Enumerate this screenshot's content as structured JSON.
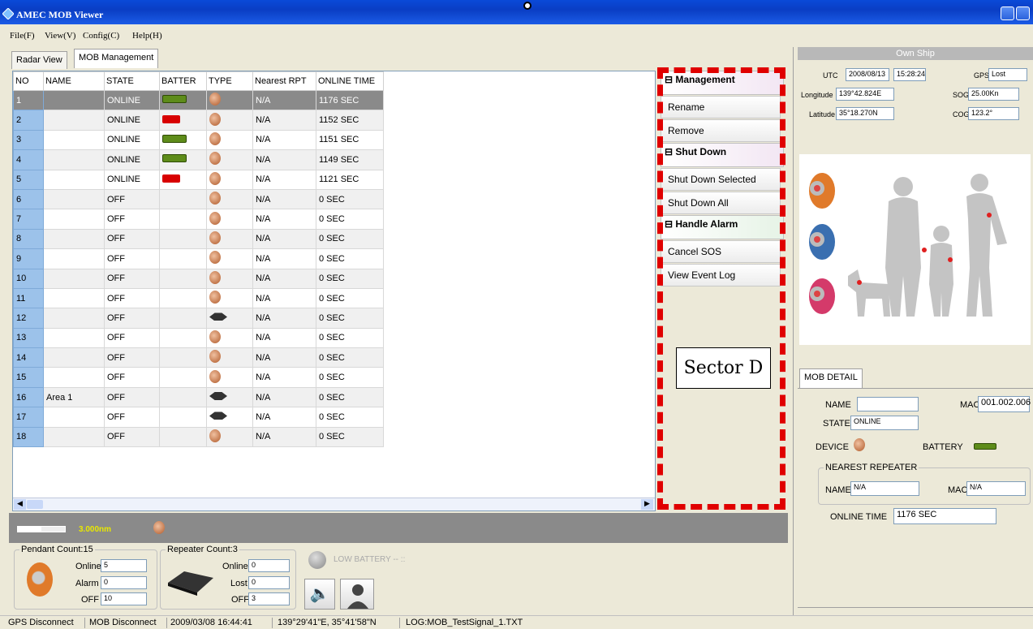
{
  "window": {
    "title": "AMEC MOB Viewer"
  },
  "menu": [
    "File(F)",
    "View(V)",
    "Config(C)",
    "Help(H)"
  ],
  "tabs": [
    "Radar View",
    "MOB Management"
  ],
  "grid": {
    "columns": [
      "NO",
      "NAME",
      "STATE",
      "BATTER",
      "TYPE",
      "Nearest RPT",
      "ONLINE TIME"
    ],
    "rows": [
      {
        "no": "1",
        "name": "",
        "state": "ONLINE",
        "battery": "good",
        "type": "pendant",
        "rpt": "N/A",
        "time": "1176 SEC"
      },
      {
        "no": "2",
        "name": "",
        "state": "ONLINE",
        "battery": "low",
        "type": "pendant",
        "rpt": "N/A",
        "time": "1152 SEC"
      },
      {
        "no": "3",
        "name": "",
        "state": "ONLINE",
        "battery": "good",
        "type": "pendant",
        "rpt": "N/A",
        "time": "1151 SEC"
      },
      {
        "no": "4",
        "name": "",
        "state": "ONLINE",
        "battery": "good",
        "type": "pendant",
        "rpt": "N/A",
        "time": "1149 SEC"
      },
      {
        "no": "5",
        "name": "",
        "state": "ONLINE",
        "battery": "low",
        "type": "pendant",
        "rpt": "N/A",
        "time": "1121 SEC"
      },
      {
        "no": "6",
        "name": "",
        "state": "OFF",
        "battery": "",
        "type": "pendant",
        "rpt": "N/A",
        "time": "0 SEC"
      },
      {
        "no": "7",
        "name": "",
        "state": "OFF",
        "battery": "",
        "type": "pendant",
        "rpt": "N/A",
        "time": "0 SEC"
      },
      {
        "no": "8",
        "name": "",
        "state": "OFF",
        "battery": "",
        "type": "pendant",
        "rpt": "N/A",
        "time": "0 SEC"
      },
      {
        "no": "9",
        "name": "",
        "state": "OFF",
        "battery": "",
        "type": "pendant",
        "rpt": "N/A",
        "time": "0 SEC"
      },
      {
        "no": "10",
        "name": "",
        "state": "OFF",
        "battery": "",
        "type": "pendant",
        "rpt": "N/A",
        "time": "0 SEC"
      },
      {
        "no": "11",
        "name": "",
        "state": "OFF",
        "battery": "",
        "type": "pendant",
        "rpt": "N/A",
        "time": "0 SEC"
      },
      {
        "no": "12",
        "name": "",
        "state": "OFF",
        "battery": "",
        "type": "repeater",
        "rpt": "N/A",
        "time": "0 SEC"
      },
      {
        "no": "13",
        "name": "",
        "state": "OFF",
        "battery": "",
        "type": "pendant",
        "rpt": "N/A",
        "time": "0 SEC"
      },
      {
        "no": "14",
        "name": "",
        "state": "OFF",
        "battery": "",
        "type": "pendant",
        "rpt": "N/A",
        "time": "0 SEC"
      },
      {
        "no": "15",
        "name": "",
        "state": "OFF",
        "battery": "",
        "type": "pendant",
        "rpt": "N/A",
        "time": "0 SEC"
      },
      {
        "no": "16",
        "name": "Area 1",
        "state": "OFF",
        "battery": "",
        "type": "repeater",
        "rpt": "N/A",
        "time": "0 SEC"
      },
      {
        "no": "17",
        "name": "",
        "state": "OFF",
        "battery": "",
        "type": "repeater",
        "rpt": "N/A",
        "time": "0 SEC"
      },
      {
        "no": "18",
        "name": "",
        "state": "OFF",
        "battery": "",
        "type": "pendant",
        "rpt": "N/A",
        "time": "0 SEC"
      }
    ]
  },
  "management": {
    "sections": [
      {
        "title": "Management",
        "buttons": [
          "Rename",
          "Remove"
        ]
      },
      {
        "title": "Shut Down",
        "buttons": [
          "Shut Down Selected",
          "Shut Down All"
        ]
      },
      {
        "title": "Handle Alarm",
        "buttons": [
          "Cancel SOS",
          "View Event Log"
        ]
      }
    ],
    "annotation": "Sector D"
  },
  "own_ship": {
    "header": "Own Ship",
    "utc_label": "UTC",
    "utc_date": "2008/08/13",
    "utc_time": "15:28:24",
    "gps_label": "GPS",
    "gps": "Lost",
    "lon_label": "Longitude",
    "lon": "139°42.824E",
    "sog_label": "SOG",
    "sog": "25.00Kn",
    "lat_label": "Latitude",
    "lat": "35°18.270N",
    "cog_label": "COG",
    "cog": "123.2°"
  },
  "mob_detail": {
    "tab": "MOB DETAIL",
    "name_label": "NAME",
    "name": "",
    "mac_label": "MAC",
    "mac": "001.002.006",
    "state_label": "STATE",
    "state": "ONLINE",
    "device_label": "DEVICE",
    "battery_label": "BATTERY",
    "repeater_group": "NEAREST REPEATER",
    "rep_name_label": "NAME",
    "rep_name": "N/A",
    "rep_mac_label": "MAC",
    "rep_mac": "N/A",
    "online_time_label": "ONLINE TIME",
    "online_time": "1176 SEC"
  },
  "bottom": {
    "scale": "3.000nm",
    "pendant_title": "Pendant Count:15",
    "pendant_online_label": "Online",
    "pendant_online": "5",
    "pendant_alarm_label": "Alarm",
    "pendant_alarm": "0",
    "pendant_off_label": "OFF",
    "pendant_off": "10",
    "repeater_title": "Repeater Count:3",
    "rep_online_label": "Online",
    "rep_online": "0",
    "rep_lost_label": "Lost",
    "rep_lost": "0",
    "rep_off_label": "OFF",
    "rep_off": "3",
    "low_battery": "LOW BATTERY -- ::"
  },
  "status": [
    "GPS Disconnect",
    "MOB Disconnect",
    "2009/03/08 16:44:41",
    "139°29'41\"E, 35°41'58\"N",
    "LOG:MOB_TestSignal_1.TXT"
  ],
  "colors": {
    "accent": "#0a4ad8",
    "alert": "#e00000",
    "selection": "#8a8a8a",
    "battery_good": "#5e8c1a",
    "battery_low": "#d80000"
  }
}
